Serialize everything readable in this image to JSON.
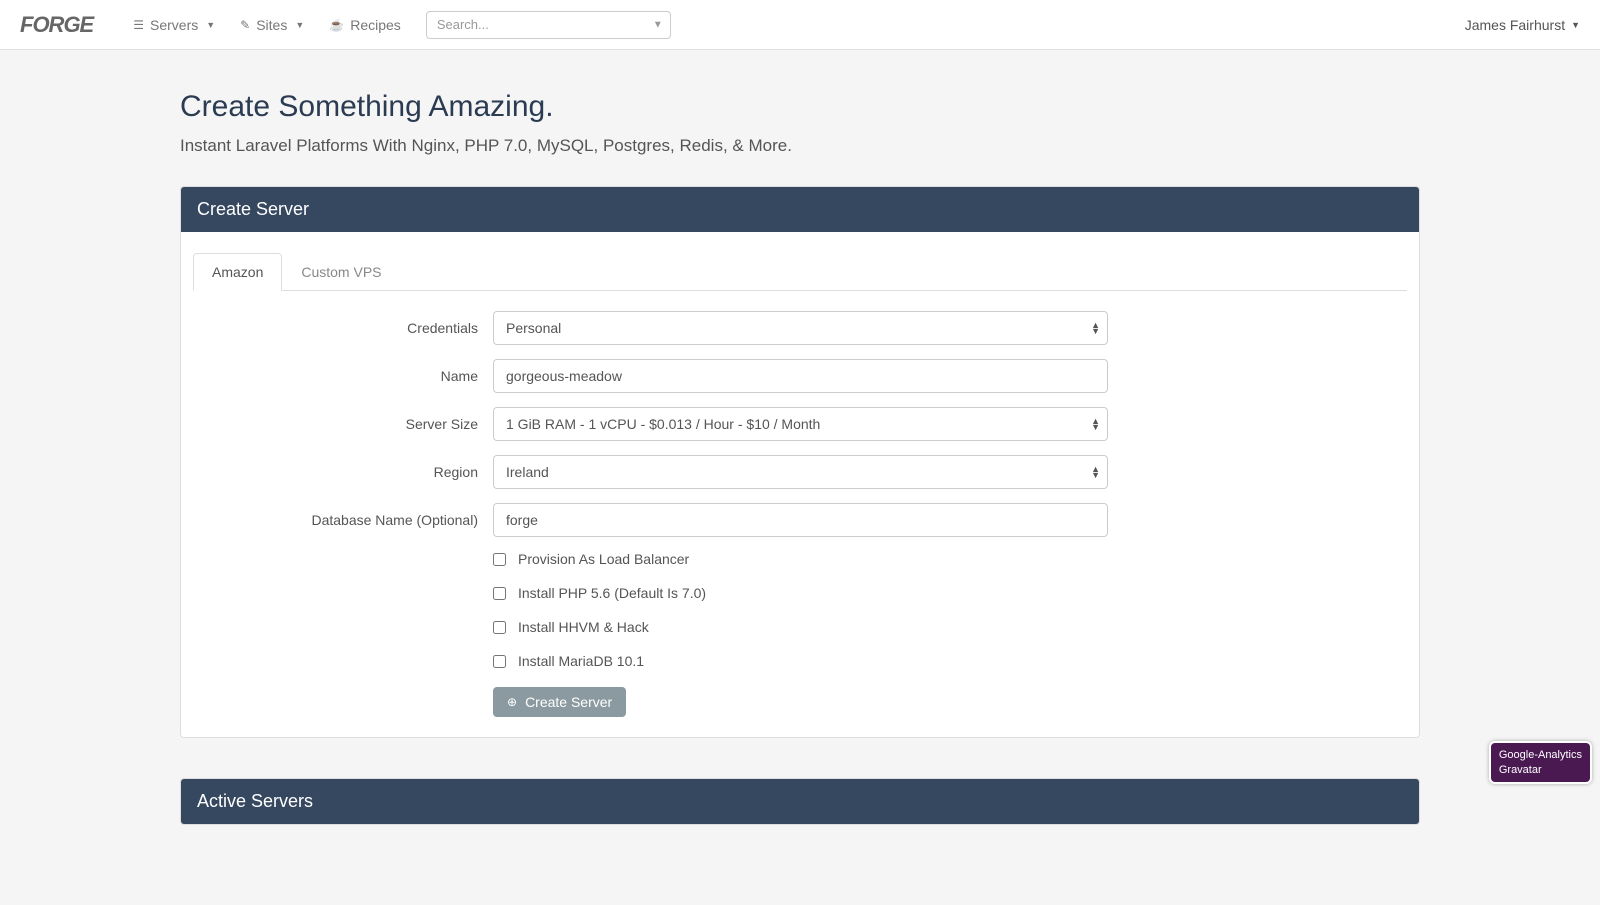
{
  "nav": {
    "logo": "FORGE",
    "servers": "Servers",
    "sites": "Sites",
    "recipes": "Recipes",
    "search_placeholder": "Search...",
    "user": "James Fairhurst"
  },
  "page": {
    "title": "Create Something Amazing.",
    "subtitle": "Instant Laravel Platforms With Nginx, PHP 7.0, MySQL, Postgres, Redis, & More."
  },
  "create_server": {
    "heading": "Create Server",
    "tabs": {
      "amazon": "Amazon",
      "custom": "Custom VPS"
    },
    "labels": {
      "credentials": "Credentials",
      "name": "Name",
      "server_size": "Server Size",
      "region": "Region",
      "database": "Database Name (Optional)"
    },
    "values": {
      "credentials": "Personal",
      "name": "gorgeous-meadow",
      "server_size": "1 GiB RAM - 1 vCPU - $0.013 / Hour - $10 / Month",
      "region": "Ireland",
      "database": "forge"
    },
    "checkboxes": {
      "load_balancer": "Provision As Load Balancer",
      "php56": "Install PHP 5.6 (Default Is 7.0)",
      "hhvm": "Install HHVM & Hack",
      "mariadb": "Install MariaDB 10.1"
    },
    "button": "Create Server"
  },
  "active_servers": {
    "heading": "Active Servers"
  },
  "badge": {
    "line1": "Google-Analytics",
    "line2": "Gravatar"
  }
}
